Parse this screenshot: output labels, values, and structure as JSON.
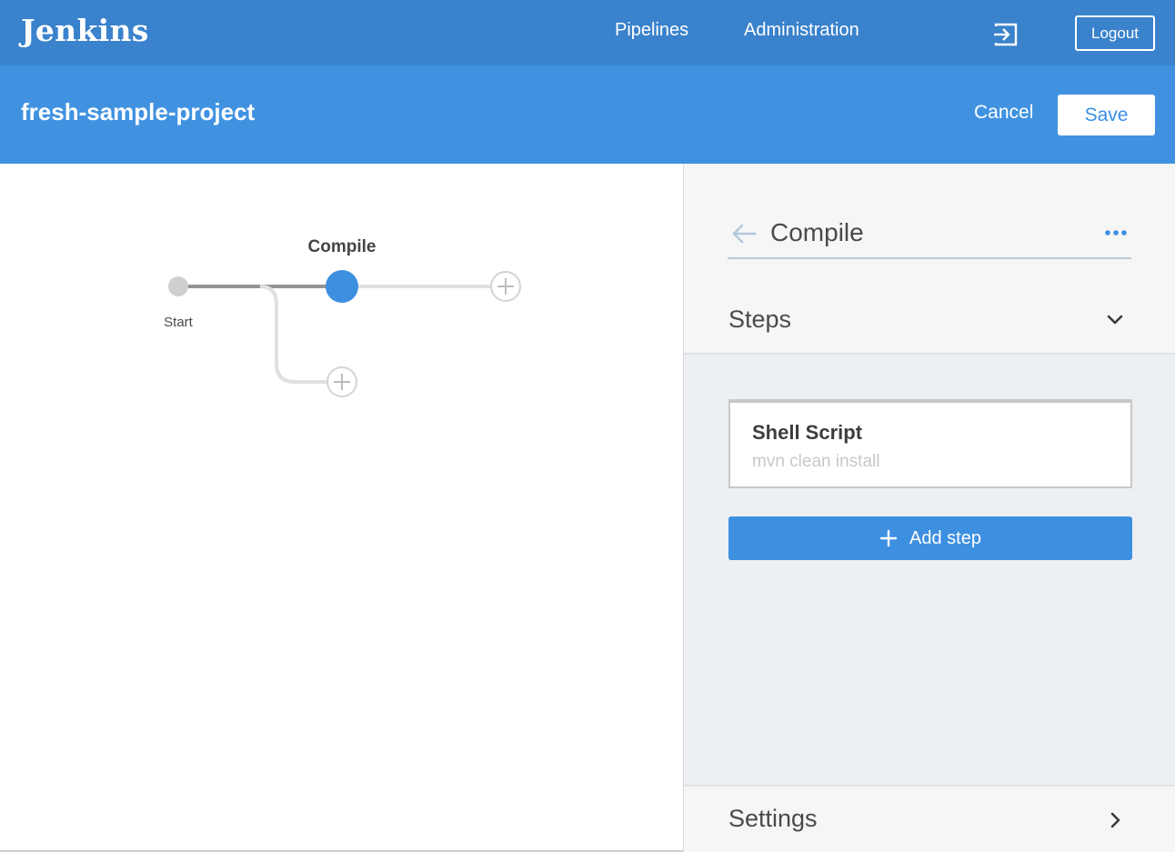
{
  "topbar": {
    "brand": "Jenkins",
    "nav": [
      {
        "label": "Pipelines"
      },
      {
        "label": "Administration"
      }
    ],
    "exit_icon": "exit-icon",
    "logout_label": "Logout"
  },
  "subbar": {
    "project_title": "fresh-sample-project",
    "cancel_label": "Cancel",
    "save_label": "Save"
  },
  "pipeline": {
    "start_label": "Start",
    "stage_label": "Compile"
  },
  "panel": {
    "title": "Compile",
    "steps_label": "Steps",
    "steps": [
      {
        "name": "Shell Script",
        "command": "mvn clean install"
      }
    ],
    "add_step_label": "Add step",
    "settings_label": "Settings"
  },
  "colors": {
    "nav_bg": "#3a82cc",
    "header_bg": "#4092e1",
    "accent": "#3d8fe0",
    "stage_node": "#3d8fe0"
  }
}
